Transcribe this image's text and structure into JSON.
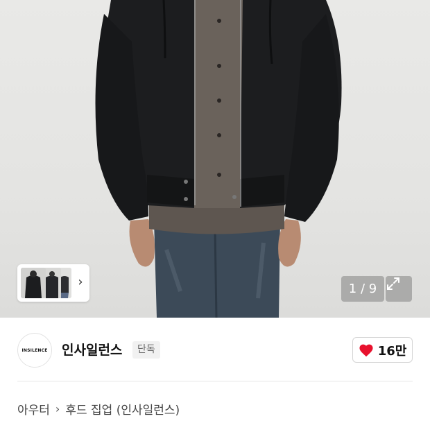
{
  "gallery": {
    "counter_text": "1 / 9",
    "expand_icon": "expand-icon",
    "thumb_next_icon": "chevron-right-icon"
  },
  "seller": {
    "logo_text": "INSILENCE",
    "name": "인사일런스",
    "badge": "단독"
  },
  "like": {
    "icon": "heart-icon",
    "count": "16만",
    "color": "#e8112d"
  },
  "breadcrumb": {
    "items": [
      {
        "label": "아우터"
      },
      {
        "label": "후드 집업 (인사일런스)"
      }
    ],
    "separator": "›"
  }
}
